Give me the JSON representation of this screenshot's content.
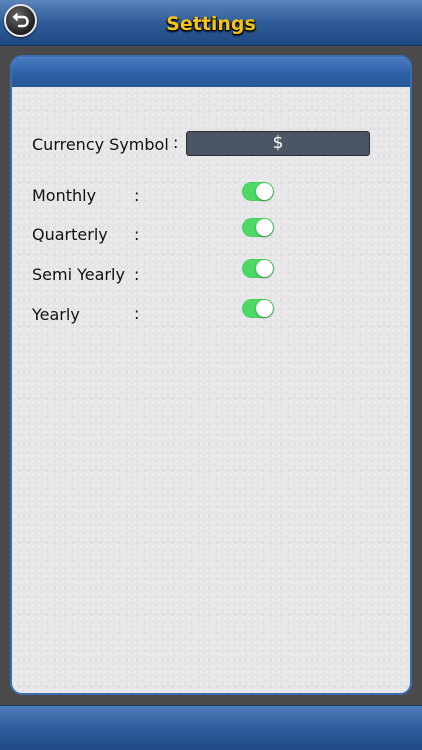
{
  "header": {
    "title": "Settings"
  },
  "settings": {
    "currency": {
      "label": "Currency Symbol",
      "colon": ":",
      "value": "$"
    },
    "rows": [
      {
        "label": "Monthly",
        "colon": ":",
        "enabled": true
      },
      {
        "label": "Quarterly",
        "colon": ":",
        "enabled": true
      },
      {
        "label": "Semi Yearly",
        "colon": ":",
        "enabled": true
      },
      {
        "label": "Yearly",
        "colon": ":",
        "enabled": true
      }
    ]
  },
  "colors": {
    "title": "#f5c21a",
    "toggle_on": "#4cd964",
    "bar_blue": "#2f5c98"
  },
  "icons": {
    "back": "back-arrow-icon"
  }
}
